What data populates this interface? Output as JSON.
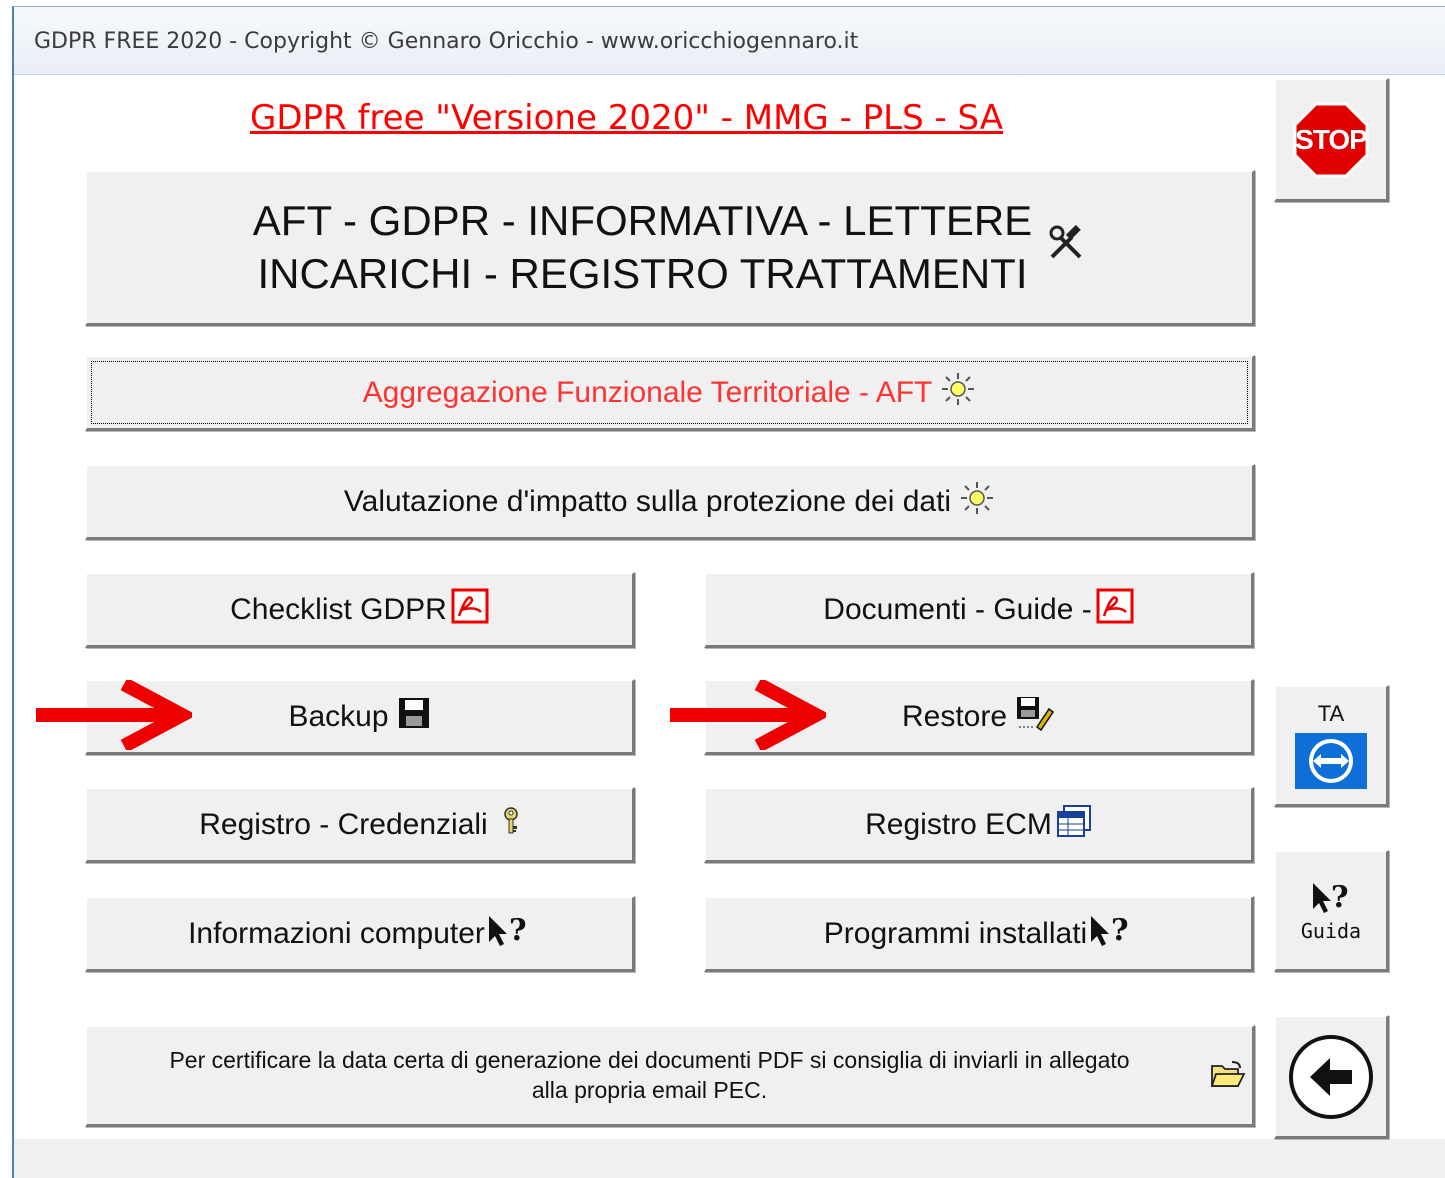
{
  "window": {
    "title": "GDPR FREE 2020 - Copyright © Gennaro Oricchio - www.oricchiogennaro.it"
  },
  "heading": "GDPR free \"Versione 2020\" - MMG - PLS - SA",
  "buttons": {
    "main": "AFT - GDPR - INFORMATIVA - LETTERE\nINCARICHI - REGISTRO TRATTAMENTI",
    "aft": "Aggregazione Funzionale Territoriale - AFT",
    "dpia": "Valutazione d'impatto sulla protezione dei dati",
    "checklist": "Checklist GDPR",
    "documenti": "Documenti - Guide -",
    "backup": "Backup",
    "restore": "Restore",
    "registro_credenziali": "Registro - Credenziali",
    "registro_ecm": "Registro ECM",
    "informazioni_computer": "Informazioni computer",
    "programmi_installati": "Programmi installati",
    "note": "Per certificare la data certa di generazione dei documenti PDF si consiglia di inviarli in allegato\nalla propria email PEC."
  },
  "side_buttons": {
    "stop": "STOP",
    "ta": "TA",
    "guida": "Guida"
  },
  "colors": {
    "heading": "#ff0000",
    "aft_text": "#ff3333",
    "arrow": "#ee0000",
    "stop_red": "#e00000",
    "teamviewer_blue": "#0e6fd6"
  },
  "icons": {
    "main": "tools-icon",
    "aft": "sun-icon",
    "dpia": "sun-icon",
    "checklist": "pdf-icon",
    "documenti": "pdf-icon",
    "backup": "floppy-disk-icon",
    "restore": "floppy-edit-icon",
    "registro_credenziali": "key-icon",
    "registro_ecm": "table-icon",
    "informazioni_computer": "help-cursor-icon",
    "programmi_installati": "help-cursor-icon",
    "note": "open-folder-icon",
    "stop": "stop-sign-icon",
    "ta": "teamviewer-icon",
    "guida": "help-cursor-icon",
    "back": "back-arrow-icon"
  }
}
